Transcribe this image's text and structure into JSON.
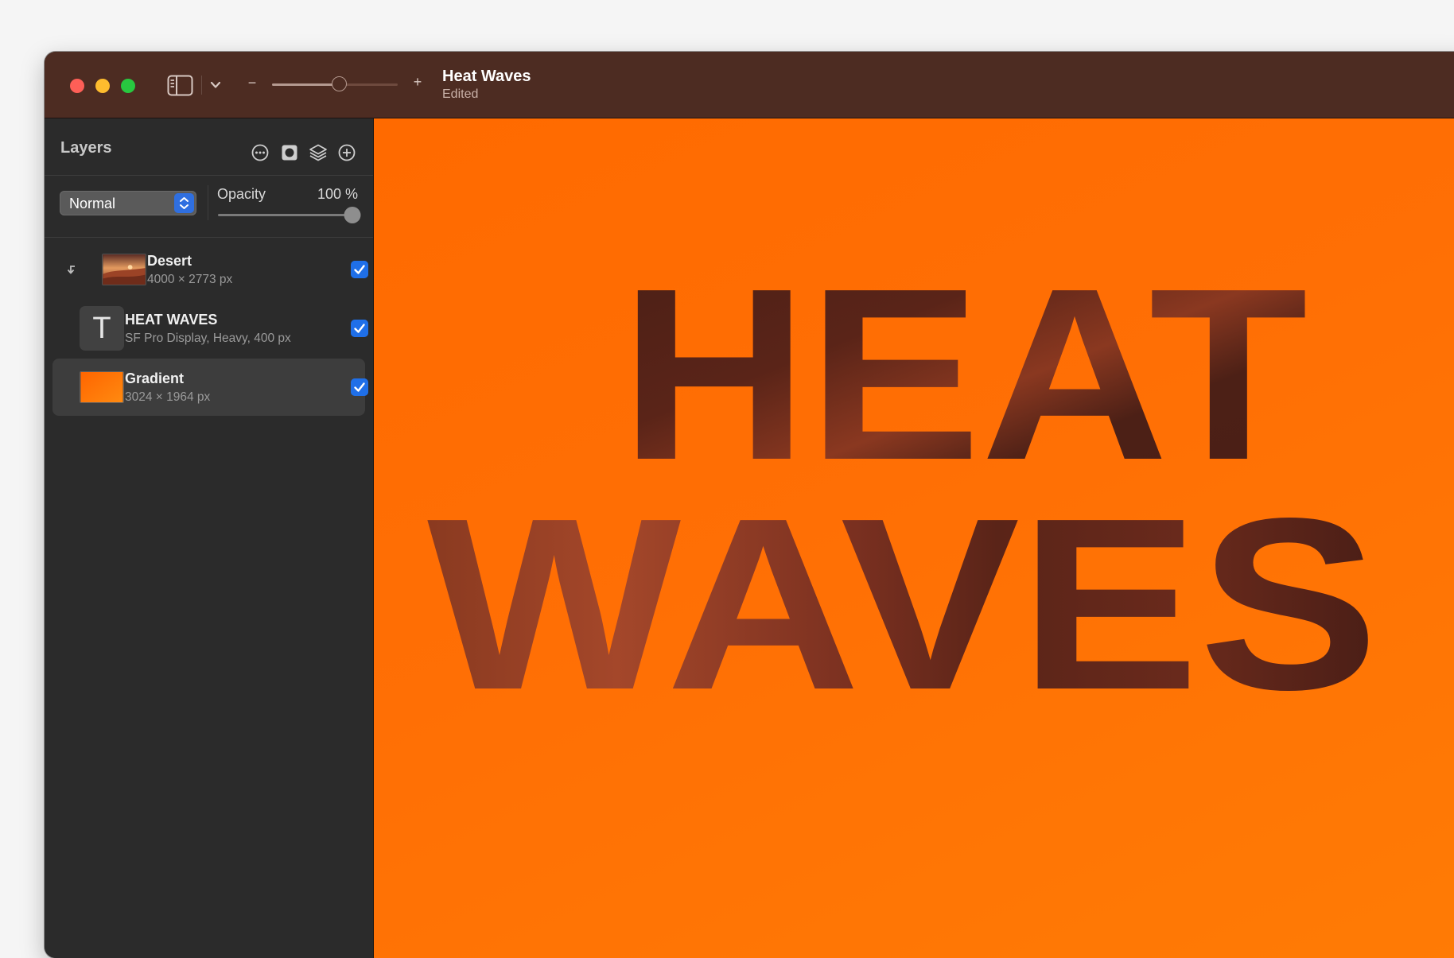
{
  "window": {
    "title": "Heat Waves",
    "subtitle": "Edited",
    "zoom_level": 0.53
  },
  "sidebar": {
    "title": "Layers",
    "header_icons": [
      "more-icon",
      "mask-icon",
      "layers-stack-icon",
      "add-icon"
    ],
    "blend_mode": "Normal",
    "opacity_label": "Opacity",
    "opacity_value": "100 %",
    "opacity_fraction": 1.0,
    "layers": [
      {
        "name": "Desert",
        "meta": "4000 × 2773 px",
        "kind": "image",
        "clipped": true,
        "visible": true,
        "selected": false
      },
      {
        "name": "HEAT WAVES",
        "meta": "SF Pro Display, Heavy, 400 px",
        "kind": "text",
        "thumb_glyph": "T",
        "visible": true,
        "selected": false
      },
      {
        "name": "Gradient",
        "meta": "3024 × 1964 px",
        "kind": "gradient",
        "visible": true,
        "selected": true
      }
    ]
  },
  "canvas": {
    "line1": "HEAT",
    "line2": "WAVES",
    "background_colors": [
      "#ff6a00",
      "#ff7b05"
    ],
    "text_fill": "#4e2218"
  }
}
